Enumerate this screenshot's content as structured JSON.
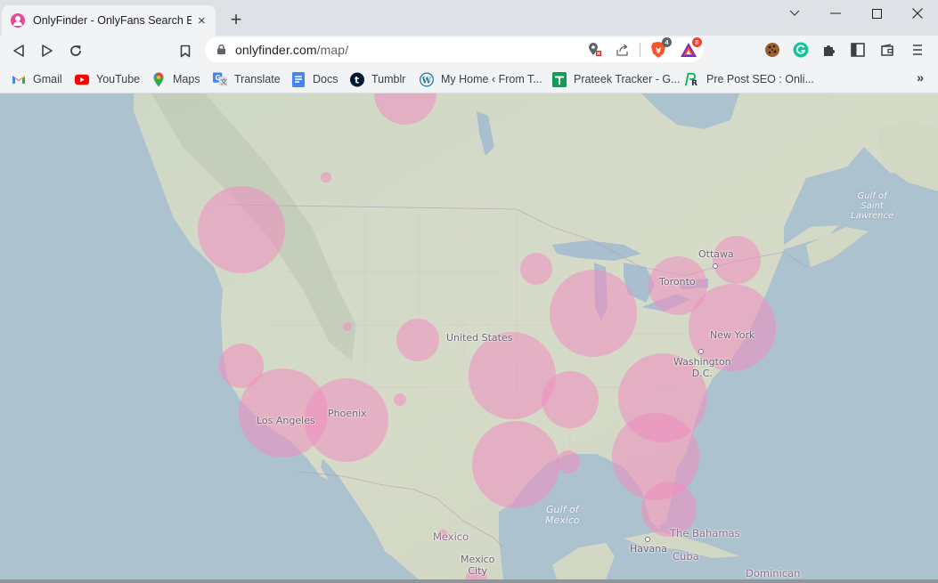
{
  "browser": {
    "tab": {
      "title": "OnlyFinder - OnlyFans Search Engine",
      "favicon": "onlyfinder-user-icon",
      "close_label": "×"
    },
    "new_tab_label": "+",
    "window_controls": [
      "tab-search",
      "minimize",
      "maximize",
      "close"
    ],
    "url": {
      "domain": "onlyfinder.com",
      "path": "/map/"
    },
    "extensions": [
      {
        "name": "brave-shields",
        "badge": "4",
        "badge_color": "#5f6368"
      },
      {
        "name": "brave-rewards",
        "badge": "8",
        "badge_color": "#ea4335"
      },
      {
        "name": "cookie-editor"
      },
      {
        "name": "grammarly"
      },
      {
        "name": "extensions-puzzle"
      },
      {
        "name": "side-panel"
      },
      {
        "name": "wallet"
      },
      {
        "name": "menu"
      }
    ]
  },
  "bookmarks": [
    {
      "label": "Gmail",
      "icon": "gmail-icon"
    },
    {
      "label": "YouTube",
      "icon": "youtube-icon"
    },
    {
      "label": "Maps",
      "icon": "maps-icon"
    },
    {
      "label": "Translate",
      "icon": "translate-icon"
    },
    {
      "label": "Docs",
      "icon": "docs-icon"
    },
    {
      "label": "Tumblr",
      "icon": "tumblr-icon"
    },
    {
      "label": "My Home ‹ From T...",
      "icon": "wordpress-icon"
    },
    {
      "label": "Prateek Tracker - G...",
      "icon": "sheets-icon"
    },
    {
      "label": "Pre Post SEO : Onli...",
      "icon": "prepostseo-icon"
    }
  ],
  "bookmarks_more": "»",
  "map": {
    "circle_color": "#f08cc0",
    "labels": {
      "ottawa": "Ottawa",
      "toronto": "Toronto",
      "new_york": "New York",
      "washington": "Washington\nD.C.",
      "washington_l1": "Washington",
      "washington_l2": "D.C.",
      "united_states": "United States",
      "los_angeles": "Los Angeles",
      "phoenix": "Phoenix",
      "mexico": "Mexico",
      "mexico_city_l1": "Mexico",
      "mexico_city_l2": "City",
      "havana": "Havana",
      "cuba": "Cuba",
      "bahamas": "The Bahamas",
      "dominican": "Dominican",
      "gulf_mexico_l1": "Gulf of",
      "gulf_mexico_l2": "Mexico",
      "gulf_stl_l1": "Gulf of",
      "gulf_stl_l2": "Saint",
      "gulf_stl_l3": "Lawrence"
    },
    "clusters": [
      {
        "region": "Manitoba",
        "size": "large"
      },
      {
        "region": "Calgary",
        "size": "tiny"
      },
      {
        "region": "Seattle / Portland",
        "size": "large"
      },
      {
        "region": "San Francisco",
        "size": "medium"
      },
      {
        "region": "Los Angeles",
        "size": "large"
      },
      {
        "region": "Phoenix",
        "size": "large"
      },
      {
        "region": "Salt Lake City",
        "size": "tiny"
      },
      {
        "region": "Denver",
        "size": "medium"
      },
      {
        "region": "Albuquerque",
        "size": "tiny"
      },
      {
        "region": "Minneapolis",
        "size": "small"
      },
      {
        "region": "Chicago",
        "size": "large"
      },
      {
        "region": "Toronto",
        "size": "medium"
      },
      {
        "region": "Ottawa / Montreal",
        "size": "medium"
      },
      {
        "region": "New York",
        "size": "large"
      },
      {
        "region": "Dallas",
        "size": "large"
      },
      {
        "region": "Memphis",
        "size": "medium"
      },
      {
        "region": "Atlanta",
        "size": "large"
      },
      {
        "region": "Houston",
        "size": "large"
      },
      {
        "region": "New Orleans",
        "size": "small"
      },
      {
        "region": "Jacksonville / Tampa",
        "size": "large"
      },
      {
        "region": "Miami",
        "size": "medium"
      },
      {
        "region": "Mexico",
        "size": "tiny"
      },
      {
        "region": "Mexico City",
        "size": "small"
      }
    ]
  }
}
